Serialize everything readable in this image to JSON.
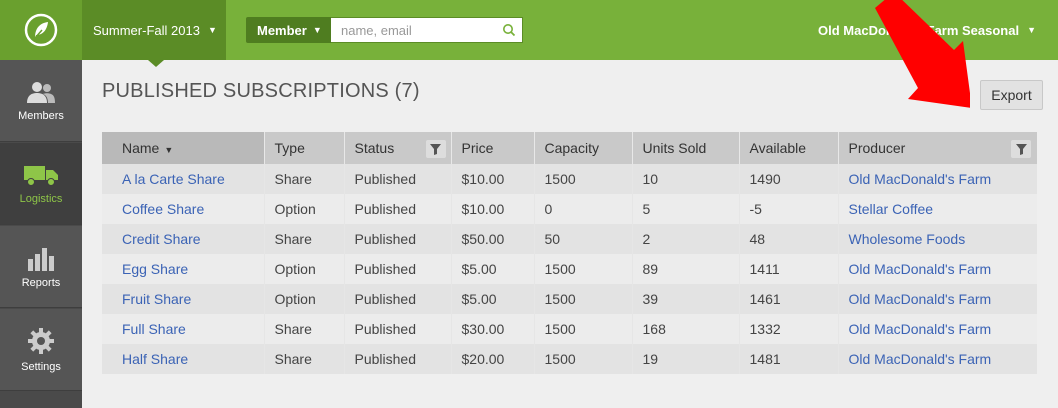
{
  "header": {
    "season_label": "Summer-Fall 2013",
    "search_scope": "Member",
    "search_placeholder": "name, email",
    "farm_label": "Old MacDonald's Farm Seasonal"
  },
  "sidebar": {
    "items": [
      {
        "label": "Members",
        "icon": "members-icon"
      },
      {
        "label": "Logistics",
        "icon": "truck-icon"
      },
      {
        "label": "Reports",
        "icon": "bar-chart-icon"
      },
      {
        "label": "Settings",
        "icon": "gear-icon"
      }
    ]
  },
  "page": {
    "title": "PUBLISHED SUBSCRIPTIONS (7)",
    "export_label": "Export"
  },
  "table": {
    "columns": [
      "Name",
      "Type",
      "Status",
      "Price",
      "Capacity",
      "Units Sold",
      "Available",
      "Producer"
    ],
    "rows": [
      [
        "A la Carte Share",
        "Share",
        "Published",
        "$10.00",
        "1500",
        "10",
        "1490",
        "Old MacDonald's Farm"
      ],
      [
        "Coffee Share",
        "Option",
        "Published",
        "$10.00",
        "0",
        "5",
        "-5",
        "Stellar Coffee"
      ],
      [
        "Credit Share",
        "Share",
        "Published",
        "$50.00",
        "50",
        "2",
        "48",
        "Wholesome Foods"
      ],
      [
        "Egg Share",
        "Option",
        "Published",
        "$5.00",
        "1500",
        "89",
        "1411",
        "Old MacDonald's Farm"
      ],
      [
        "Fruit Share",
        "Option",
        "Published",
        "$5.00",
        "1500",
        "39",
        "1461",
        "Old MacDonald's Farm"
      ],
      [
        "Full Share",
        "Share",
        "Published",
        "$30.00",
        "1500",
        "168",
        "1332",
        "Old MacDonald's Farm"
      ],
      [
        "Half Share",
        "Share",
        "Published",
        "$20.00",
        "1500",
        "19",
        "1481",
        "Old MacDonald's Farm"
      ]
    ]
  },
  "colors": {
    "brand_green": "#78b13a",
    "link_blue": "#3b63b5",
    "annotation_red": "#ff0000"
  }
}
